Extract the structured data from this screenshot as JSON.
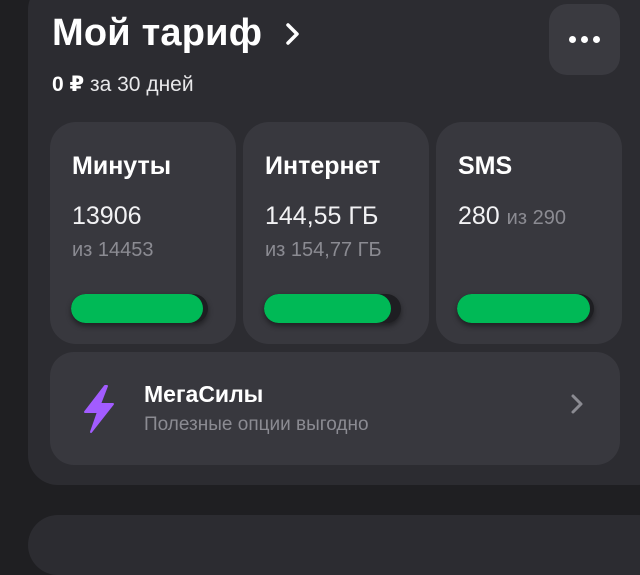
{
  "header": {
    "title": "Мой тариф",
    "price": "0 ₽",
    "period": "за 30 дней"
  },
  "tiles": [
    {
      "title": "Минуты",
      "value": "13906",
      "limit": "из 14453",
      "progress": 0.96
    },
    {
      "title": "Интернет",
      "value": "144,55 ГБ",
      "limit": "из 154,77 ГБ",
      "progress": 0.93
    },
    {
      "title": "SMS",
      "value": "280",
      "of_inline": "из 290",
      "progress": 0.97
    }
  ],
  "megasila": {
    "title": "МегаСилы",
    "subtitle": "Полезные опции выгодно"
  },
  "icons": {
    "title_chevron": "chevron-right-icon",
    "more": "more-horizontal-icon",
    "megasila": "lightning-icon",
    "megasila_chevron": "chevron-right-icon"
  },
  "colors": {
    "accent_green": "#00b956",
    "lightning_purple": "#a25cff",
    "card_bg": "#2c2c31",
    "tile_bg": "#38383e"
  }
}
